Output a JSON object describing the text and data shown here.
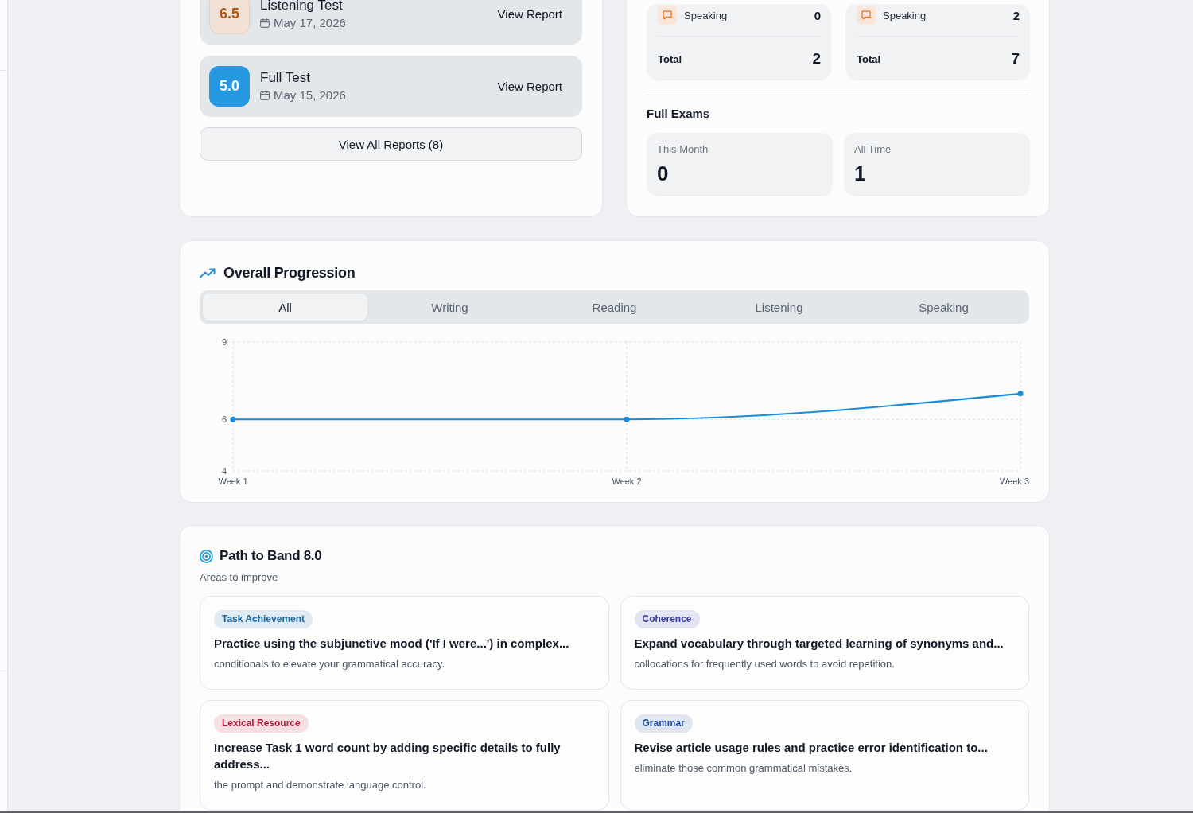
{
  "recent_reports": {
    "items": [
      {
        "score": "6.5",
        "kind": "soft",
        "color": "#b4540f",
        "title": "Listening Test",
        "date": "May 17, 2026",
        "action": "View Report"
      },
      {
        "score": "5.0",
        "kind": "solid",
        "color": "#2698e0",
        "title": "Full Test",
        "date": "May 15, 2026",
        "action": "View Report"
      }
    ],
    "view_all": "View All Reports (8)"
  },
  "test_counts": {
    "groups": [
      {
        "rows": [
          {
            "kind": "speaking",
            "label": "Speaking",
            "value": "0"
          }
        ],
        "total_label": "Total",
        "total": "2"
      },
      {
        "rows": [
          {
            "kind": "speaking",
            "label": "Speaking",
            "value": "2"
          }
        ],
        "total_label": "Total",
        "total": "7"
      }
    ],
    "full_exams": {
      "title": "Full Exams",
      "stats": [
        {
          "label": "This Month",
          "value": "0"
        },
        {
          "label": "All Time",
          "value": "1"
        }
      ]
    }
  },
  "progression": {
    "title": "Overall Progression",
    "tabs": [
      {
        "label": "All",
        "selected": true
      },
      {
        "label": "Writing",
        "selected": false
      },
      {
        "label": "Reading",
        "selected": false
      },
      {
        "label": "Listening",
        "selected": false
      },
      {
        "label": "Speaking",
        "selected": false
      }
    ],
    "chart_data": {
      "type": "line",
      "categories": [
        "Week 1",
        "Week 2",
        "Week 3"
      ],
      "series": [
        {
          "color": "#1a8ad6",
          "marker": true,
          "values": [
            6,
            6,
            7
          ]
        }
      ],
      "ylim": [
        4,
        9
      ],
      "yticks": [
        4,
        6,
        9
      ]
    }
  },
  "path": {
    "title": "Path to Band 8.0",
    "subtitle": "Areas to improve",
    "items": [
      {
        "tag": "Task Achievement",
        "color": "#1b6aa0",
        "title": "Practice using the subjunctive mood ('If I were...') in complex...",
        "description": "conditionals to elevate your grammatical accuracy."
      },
      {
        "tag": "Coherence",
        "color": "#3a3f9e",
        "title": "Expand vocabulary through targeted learning of synonyms and...",
        "description": "collocations for frequently used words to avoid repetition."
      },
      {
        "tag": "Lexical Resource",
        "color": "#b5193a",
        "title": "Increase Task 1 word count by adding specific details to fully address...",
        "description": "the prompt and demonstrate language control."
      },
      {
        "tag": "Grammar",
        "color": "#1c4ea0",
        "title": "Revise article usage rules and practice error identification to...",
        "description": "eliminate those common grammatical mistakes."
      }
    ]
  }
}
